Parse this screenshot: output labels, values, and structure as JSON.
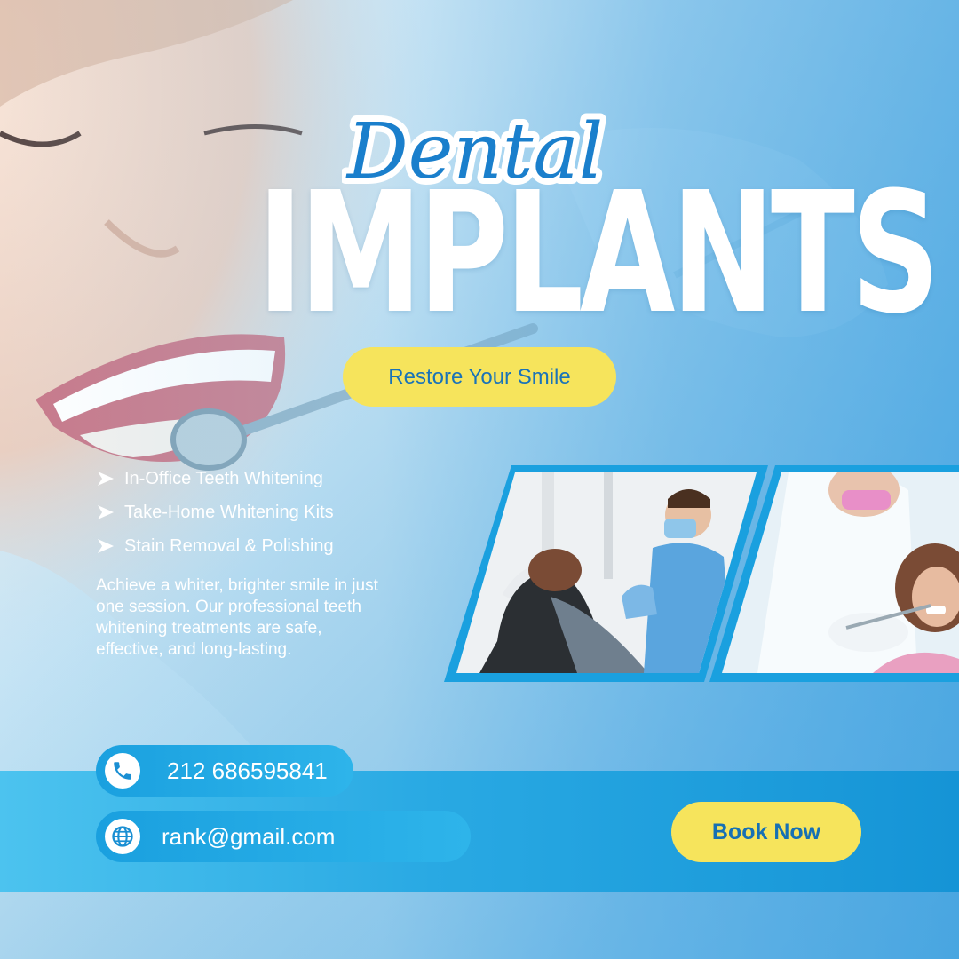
{
  "header": {
    "script_title": "Dental",
    "main_title": "IMPLANTS",
    "tagline": "Restore Your Smile"
  },
  "services": [
    {
      "label": "In-Office Teeth Whitening",
      "icon": "chevron-right-icon"
    },
    {
      "label": "Take-Home Whitening Kits",
      "icon": "chevron-right-icon"
    },
    {
      "label": "Stain Removal & Polishing",
      "icon": "chevron-right-icon"
    }
  ],
  "description": "Achieve a whiter, brighter smile in just one session. Our professional teeth whitening treatments are safe, effective, and long-lasting.",
  "contact": {
    "phone": "212 686595841",
    "phone_icon": "phone-icon",
    "email": "rank@gmail.com",
    "email_icon": "globe-icon"
  },
  "cta": {
    "label": "Book Now"
  },
  "colors": {
    "accent_yellow": "#f6e45c",
    "brand_blue": "#1a73b8",
    "sky_blue": "#29a9e3"
  }
}
